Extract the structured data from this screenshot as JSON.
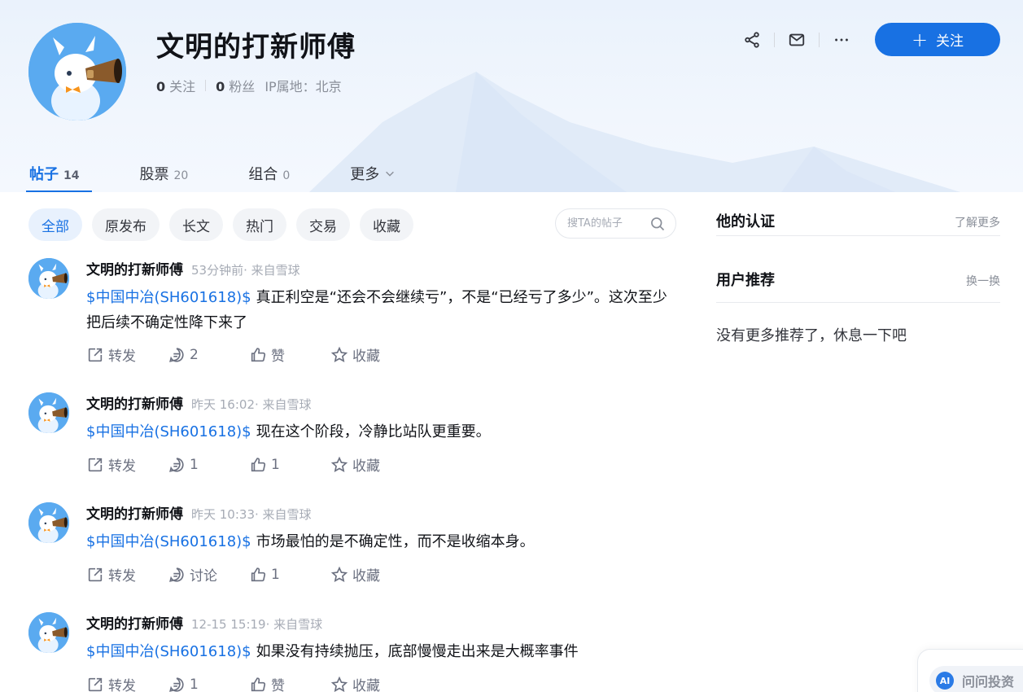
{
  "profile": {
    "name": "文明的打新师傅",
    "following_count": "0",
    "following_label": "关注",
    "followers_count": "0",
    "followers_label": "粉丝",
    "ip_location": "IP属地：北京"
  },
  "top_actions": {
    "share_icon": "share-icon",
    "mail_icon": "mail-icon",
    "more_icon": "more-dots-icon",
    "follow_plus": "+",
    "follow_label": "关注"
  },
  "tabs": [
    {
      "label": "帖子",
      "count": "14",
      "active": true
    },
    {
      "label": "股票",
      "count": "20"
    },
    {
      "label": "组合",
      "count": "0"
    },
    {
      "label": "更多",
      "count": ""
    }
  ],
  "filters": [
    "全部",
    "原发布",
    "长文",
    "热门",
    "交易",
    "收藏"
  ],
  "post_search": {
    "placeholder": "搜TA的帖子"
  },
  "posts": [
    {
      "author": "文明的打新师傅",
      "meta": "53分钟前· 来自雪球",
      "stock": "$中国中冶(SH601618)$",
      "text": "真正利空是“还会不会继续亏”，不是“已经亏了多少”。这次至少把后续不确定性降下来了",
      "repost": "转发",
      "comment": "2",
      "like": "赞",
      "fav": "收藏"
    },
    {
      "author": "文明的打新师傅",
      "meta": "昨天 16:02· 来自雪球",
      "stock": "$中国中冶(SH601618)$",
      "text": "现在这个阶段，冷静比站队更重要。",
      "repost": "转发",
      "comment": "1",
      "like": "1",
      "fav": "收藏"
    },
    {
      "author": "文明的打新师傅",
      "meta": "昨天 10:33· 来自雪球",
      "stock": "$中国中冶(SH601618)$",
      "text": "市场最怕的是不确定性，而不是收缩本身。",
      "repost": "转发",
      "comment": "讨论",
      "like": "1",
      "fav": "收藏"
    },
    {
      "author": "文明的打新师傅",
      "meta": "12-15 15:19· 来自雪球",
      "stock": "$中国中冶(SH601618)$",
      "text": "如果没有持续抛压，底部慢慢走出来是大概率事件",
      "repost": "转发",
      "comment": "1",
      "like": "赞",
      "fav": "收藏"
    }
  ],
  "sidebar": {
    "cert_title": "他的认证",
    "cert_link": "了解更多",
    "rec_title": "用户推荐",
    "rec_link": "换一换",
    "empty_tip": "没有更多推荐了，休息一下吧"
  },
  "ai_assistant": {
    "badge": "AI",
    "label": "问问投资"
  },
  "colors": {
    "accent": "#1871e3",
    "banner": "#eaf2fc",
    "text": "#111318",
    "muted": "#8a8f99"
  }
}
